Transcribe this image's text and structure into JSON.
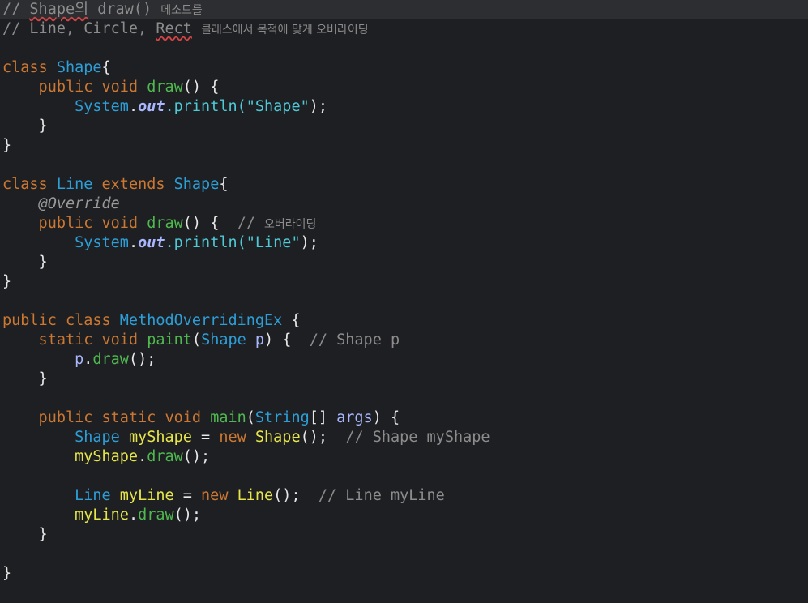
{
  "colors": {
    "background": "#1e1f22",
    "current_line": "#2d2e31",
    "keyword": "#cc7832",
    "type": "#2d9fd8",
    "method": "#4fb84f",
    "string": "#4ec9d6",
    "comment": "#8c8c8c",
    "annotation": "#9a9a9a",
    "variable": "#e6e64a",
    "param": "#a9b7ff",
    "punct": "#e8e8e8",
    "squiggle": "#d64545"
  },
  "editor": {
    "lines": [
      [
        {
          "t": "// ",
          "c": "comment"
        },
        {
          "t": "Shape의",
          "c": "comment",
          "s": 1
        },
        {
          "t": " draw() ",
          "c": "comment"
        },
        {
          "t": "메소드를",
          "c": "comment",
          "k": 1
        }
      ],
      [
        {
          "t": "// Line, Circle, ",
          "c": "comment"
        },
        {
          "t": "Rect",
          "c": "comment",
          "s": 1
        },
        {
          "t": " ",
          "c": "comment"
        },
        {
          "t": "클래스에서 목적에 맞게 오버라이딩",
          "c": "comment",
          "k": 1
        }
      ],
      [],
      [
        {
          "t": "class ",
          "c": "keyword"
        },
        {
          "t": "Shape",
          "c": "type"
        },
        {
          "t": "{",
          "c": "punct"
        }
      ],
      [
        {
          "t": "    public void ",
          "c": "keyword"
        },
        {
          "t": "draw",
          "c": "method"
        },
        {
          "t": "() {",
          "c": "punct"
        }
      ],
      [
        {
          "t": "        System",
          "c": "type"
        },
        {
          "t": ".",
          "c": "punct"
        },
        {
          "t": "out",
          "c": "param",
          "i": 1,
          "b": 1
        },
        {
          "t": ".println(",
          "c": "string"
        },
        {
          "t": "\"Shape\"",
          "c": "string"
        },
        {
          "t": ");",
          "c": "punct"
        }
      ],
      [
        {
          "t": "    }",
          "c": "punct"
        }
      ],
      [
        {
          "t": "}",
          "c": "punct"
        }
      ],
      [],
      [
        {
          "t": "class ",
          "c": "keyword"
        },
        {
          "t": "Line ",
          "c": "type"
        },
        {
          "t": "extends ",
          "c": "keyword"
        },
        {
          "t": "Shape",
          "c": "type"
        },
        {
          "t": "{",
          "c": "punct"
        }
      ],
      [
        {
          "t": "    @Override",
          "c": "annotation",
          "i": 1
        }
      ],
      [
        {
          "t": "    public void ",
          "c": "keyword"
        },
        {
          "t": "draw",
          "c": "method"
        },
        {
          "t": "() {  ",
          "c": "punct"
        },
        {
          "t": "// ",
          "c": "comment"
        },
        {
          "t": "오버라이딩",
          "c": "comment",
          "k": 1
        }
      ],
      [
        {
          "t": "        System",
          "c": "type"
        },
        {
          "t": ".",
          "c": "punct"
        },
        {
          "t": "out",
          "c": "param",
          "i": 1,
          "b": 1
        },
        {
          "t": ".println(",
          "c": "string"
        },
        {
          "t": "\"Line\"",
          "c": "string"
        },
        {
          "t": ");",
          "c": "punct"
        }
      ],
      [
        {
          "t": "    }",
          "c": "punct"
        }
      ],
      [
        {
          "t": "}",
          "c": "punct"
        }
      ],
      [],
      [
        {
          "t": "public class ",
          "c": "keyword"
        },
        {
          "t": "MethodOverridingEx ",
          "c": "type"
        },
        {
          "t": "{",
          "c": "punct"
        }
      ],
      [
        {
          "t": "    static void ",
          "c": "keyword"
        },
        {
          "t": "paint",
          "c": "method"
        },
        {
          "t": "(",
          "c": "punct"
        },
        {
          "t": "Shape ",
          "c": "type"
        },
        {
          "t": "p",
          "c": "param"
        },
        {
          "t": ") {  ",
          "c": "punct"
        },
        {
          "t": "// Shape p",
          "c": "comment"
        }
      ],
      [
        {
          "t": "        p",
          "c": "param"
        },
        {
          "t": ".",
          "c": "punct"
        },
        {
          "t": "draw",
          "c": "method"
        },
        {
          "t": "();",
          "c": "punct"
        }
      ],
      [
        {
          "t": "    }",
          "c": "punct"
        }
      ],
      [],
      [
        {
          "t": "    public static void ",
          "c": "keyword"
        },
        {
          "t": "main",
          "c": "method"
        },
        {
          "t": "(",
          "c": "punct"
        },
        {
          "t": "String",
          "c": "type"
        },
        {
          "t": "[] ",
          "c": "punct"
        },
        {
          "t": "args",
          "c": "param"
        },
        {
          "t": ") {",
          "c": "punct"
        }
      ],
      [
        {
          "t": "        Shape ",
          "c": "type"
        },
        {
          "t": "myShape",
          "c": "variable"
        },
        {
          "t": " = ",
          "c": "punct"
        },
        {
          "t": "new ",
          "c": "keyword"
        },
        {
          "t": "Shape",
          "c": "variable"
        },
        {
          "t": "();  ",
          "c": "punct"
        },
        {
          "t": "// Shape myShape",
          "c": "comment"
        }
      ],
      [
        {
          "t": "        myShape",
          "c": "variable"
        },
        {
          "t": ".",
          "c": "punct"
        },
        {
          "t": "draw",
          "c": "method"
        },
        {
          "t": "();",
          "c": "punct"
        }
      ],
      [],
      [
        {
          "t": "        Line ",
          "c": "type"
        },
        {
          "t": "myLine",
          "c": "variable"
        },
        {
          "t": " = ",
          "c": "punct"
        },
        {
          "t": "new ",
          "c": "keyword"
        },
        {
          "t": "Line",
          "c": "variable"
        },
        {
          "t": "();  ",
          "c": "punct"
        },
        {
          "t": "// Line myLine",
          "c": "comment"
        }
      ],
      [
        {
          "t": "        myLine",
          "c": "variable"
        },
        {
          "t": ".",
          "c": "punct"
        },
        {
          "t": "draw",
          "c": "method"
        },
        {
          "t": "();",
          "c": "punct"
        }
      ],
      [
        {
          "t": "    }",
          "c": "punct"
        }
      ],
      [],
      [
        {
          "t": "}",
          "c": "punct"
        }
      ]
    ]
  }
}
